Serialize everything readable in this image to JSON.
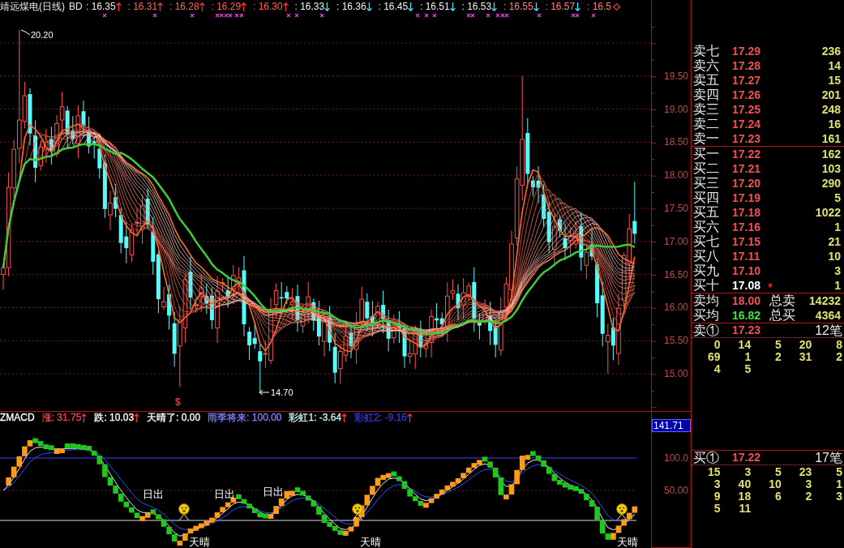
{
  "chart_header": {
    "title": "靖远煤电(日线)",
    "code": "BD",
    "values": [
      {
        "text": ": 16.35",
        "color": "#f0f0f0",
        "kind": "up"
      },
      {
        "text": ": 16.31",
        "color": "#ff6060",
        "kind": "up"
      },
      {
        "text": ": 16.28",
        "color": "#ff6060",
        "kind": "up"
      },
      {
        "text": ": 16.29",
        "color": "#ff6060",
        "kind": "up"
      },
      {
        "text": ": 16.30",
        "color": "#ff6060",
        "kind": "up"
      },
      {
        "text": ": 16.33",
        "color": "#f0f0f0",
        "kind": "down"
      },
      {
        "text": ": 16.36",
        "color": "#f0f0f0",
        "kind": "down"
      },
      {
        "text": ": 16.45",
        "color": "#f0f0f0",
        "kind": "down"
      },
      {
        "text": ": 16.51",
        "color": "#f0f0f0",
        "kind": "down"
      },
      {
        "text": ": 16.53",
        "color": "#f0f0f0",
        "kind": "down"
      },
      {
        "text": ": 16.55",
        "color": "#ff8080",
        "kind": "down"
      },
      {
        "text": ": 16.57",
        "color": "#ff8080",
        "kind": "down"
      },
      {
        "text": ": 16.5",
        "color": "#ff8080",
        "kind": "diamond"
      }
    ]
  },
  "price_chart": {
    "high_label": "20.20",
    "low_label": "14.70",
    "signal_mark": "$"
  },
  "price_axis": [
    "19.50",
    "19.00",
    "18.50",
    "18.00",
    "17.50",
    "17.00",
    "16.50",
    "16.00",
    "15.50",
    "15.00"
  ],
  "indicator_header": [
    {
      "text": "ZMACD",
      "color": "#ffffff",
      "arrow": false
    },
    {
      "text": "涨: 31.75",
      "color": "#ff4040",
      "arrow": true
    },
    {
      "text": "跌: 10.03",
      "color": "#ffffff",
      "arrow": true
    },
    {
      "text": "天晴了: 0.00",
      "color": "#ffffff",
      "arrow": false
    },
    {
      "text": "雨季将来: 100.00",
      "color": "#8080ff",
      "arrow": false
    },
    {
      "text": "彩虹1: -3.64",
      "color": "#c8f0f0",
      "arrow": true
    },
    {
      "text": "彩虹2: -9.16",
      "color": "#3838e0",
      "arrow": true
    }
  ],
  "indicator_chart": {
    "annotations": [
      {
        "kind": "sunrise",
        "text": "日出"
      },
      {
        "kind": "sunrise",
        "text": "日出"
      },
      {
        "kind": "sunrise",
        "text": "日出"
      },
      {
        "kind": "sunny",
        "text": "天晴"
      },
      {
        "kind": "sunny",
        "text": "天晴"
      },
      {
        "kind": "sunny",
        "text": "天晴"
      }
    ]
  },
  "indicator_axis": {
    "current": "141.71",
    "ticks": [
      "100.0",
      "50.00"
    ]
  },
  "order_book": {
    "asks": [
      {
        "label": "卖七",
        "price": "17.29",
        "color": "#f05050",
        "volume": "236"
      },
      {
        "label": "卖六",
        "price": "17.28",
        "color": "#f05050",
        "volume": "14"
      },
      {
        "label": "卖五",
        "price": "17.27",
        "color": "#f05050",
        "volume": "15"
      },
      {
        "label": "卖四",
        "price": "17.26",
        "color": "#f05050",
        "volume": "201"
      },
      {
        "label": "卖三",
        "price": "17.25",
        "color": "#f05050",
        "volume": "248"
      },
      {
        "label": "卖二",
        "price": "17.24",
        "color": "#f05050",
        "volume": "16"
      },
      {
        "label": "卖一",
        "price": "17.23",
        "color": "#f05050",
        "volume": "161"
      }
    ],
    "bids": [
      {
        "label": "买一",
        "price": "17.22",
        "color": "#f05050",
        "volume": "162",
        "flagged": false
      },
      {
        "label": "买二",
        "price": "17.21",
        "color": "#f05050",
        "volume": "103",
        "flagged": false
      },
      {
        "label": "买三",
        "price": "17.20",
        "color": "#f05050",
        "volume": "290",
        "flagged": false
      },
      {
        "label": "买四",
        "price": "17.19",
        "color": "#f05050",
        "volume": "5",
        "flagged": false
      },
      {
        "label": "买五",
        "price": "17.18",
        "color": "#f05050",
        "volume": "1022",
        "flagged": false
      },
      {
        "label": "买六",
        "price": "17.16",
        "color": "#f05050",
        "volume": "1",
        "flagged": false
      },
      {
        "label": "买七",
        "price": "17.15",
        "color": "#f05050",
        "volume": "21",
        "flagged": false
      },
      {
        "label": "买八",
        "price": "17.11",
        "color": "#f05050",
        "volume": "10",
        "flagged": false
      },
      {
        "label": "买九",
        "price": "17.10",
        "color": "#f05050",
        "volume": "3",
        "flagged": false
      },
      {
        "label": "买十",
        "price": "17.08",
        "color": "#ffffff",
        "volume": "1",
        "flagged": true
      }
    ],
    "summary": [
      {
        "label": "卖均",
        "price": "18.00",
        "color": "#f05050",
        "total_label": "总卖",
        "total": "14232"
      },
      {
        "label": "买均",
        "price": "16.82",
        "color": "#40e040",
        "total_label": "总买",
        "total": "4364"
      }
    ]
  },
  "trade_ticks": [
    {
      "label": "卖①",
      "price": "17.23",
      "color": "#f05050",
      "count": "12笔",
      "rows": [
        [
          "0",
          "14",
          "5",
          "20",
          "8"
        ],
        [
          "69",
          "1",
          "2",
          "31",
          "2"
        ],
        [
          "4",
          "5"
        ]
      ]
    },
    {
      "label": "买①",
      "price": "17.22",
      "color": "#f05050",
      "count": "17笔",
      "rows": [
        [
          "15",
          "3",
          "5",
          "23",
          "5"
        ],
        [
          "3",
          "40",
          "10",
          "3",
          "1"
        ],
        [
          "9",
          "18",
          "6",
          "2",
          "3"
        ],
        [
          "5",
          "11"
        ]
      ]
    }
  ]
}
